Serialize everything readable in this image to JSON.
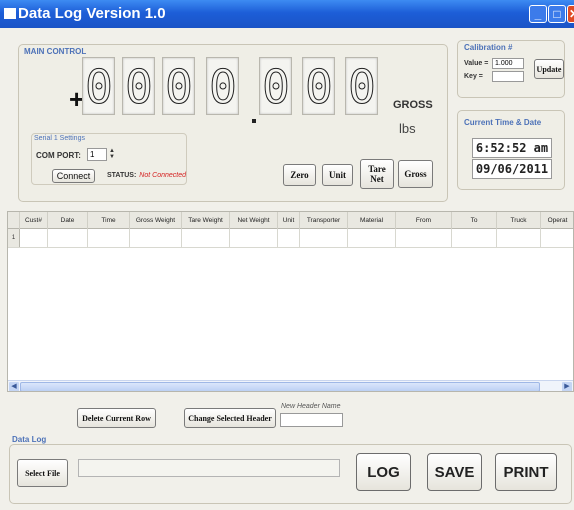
{
  "window": {
    "title": "Data Log Version 1.0"
  },
  "main_control": {
    "label": "MAIN CONTROL",
    "sign": "+",
    "digits": [
      "0",
      "0",
      "0",
      "0",
      "0",
      "0",
      "0"
    ],
    "gross_label": "GROSS",
    "unit_label": "lbs",
    "buttons": {
      "zero": "Zero",
      "unit": "Unit",
      "tare_line1": "Tare",
      "tare_line2": "Net",
      "gross": "Gross"
    }
  },
  "serial": {
    "caption": "Serial 1 Settings",
    "com_label": "COM PORT:",
    "com_value": "1",
    "connect_label": "Connect",
    "status_label": "STATUS:",
    "status_value": "Not Connected"
  },
  "calibration": {
    "label": "Calibration #",
    "value_label": "Value =",
    "value": "1.000",
    "key_label": "Key =",
    "key": "",
    "update_label": "Update"
  },
  "time_date": {
    "label": "Current Time & Date",
    "time": "6:52:52 am",
    "date": "09/06/2011"
  },
  "grid": {
    "columns": [
      "Cust#",
      "Date",
      "Time",
      "Gross Weight",
      "Tare Weight",
      "Net Weight",
      "Unit",
      "Transporter",
      "Material",
      "From",
      "To",
      "Truck",
      "Operat"
    ],
    "row_number": "1"
  },
  "controls": {
    "delete_row": "Delete Current Row",
    "change_header": "Change Selected Header",
    "new_header_label": "New Header Name",
    "new_header_value": ""
  },
  "data_log": {
    "label": "Data Log",
    "select_file": "Select File",
    "file_path": "",
    "log": "LOG",
    "save": "SAVE",
    "print": "PRINT"
  },
  "colors": {
    "titlebar": "#1d5ed8",
    "group_label": "#4d72b8",
    "status_error": "#d42020"
  }
}
